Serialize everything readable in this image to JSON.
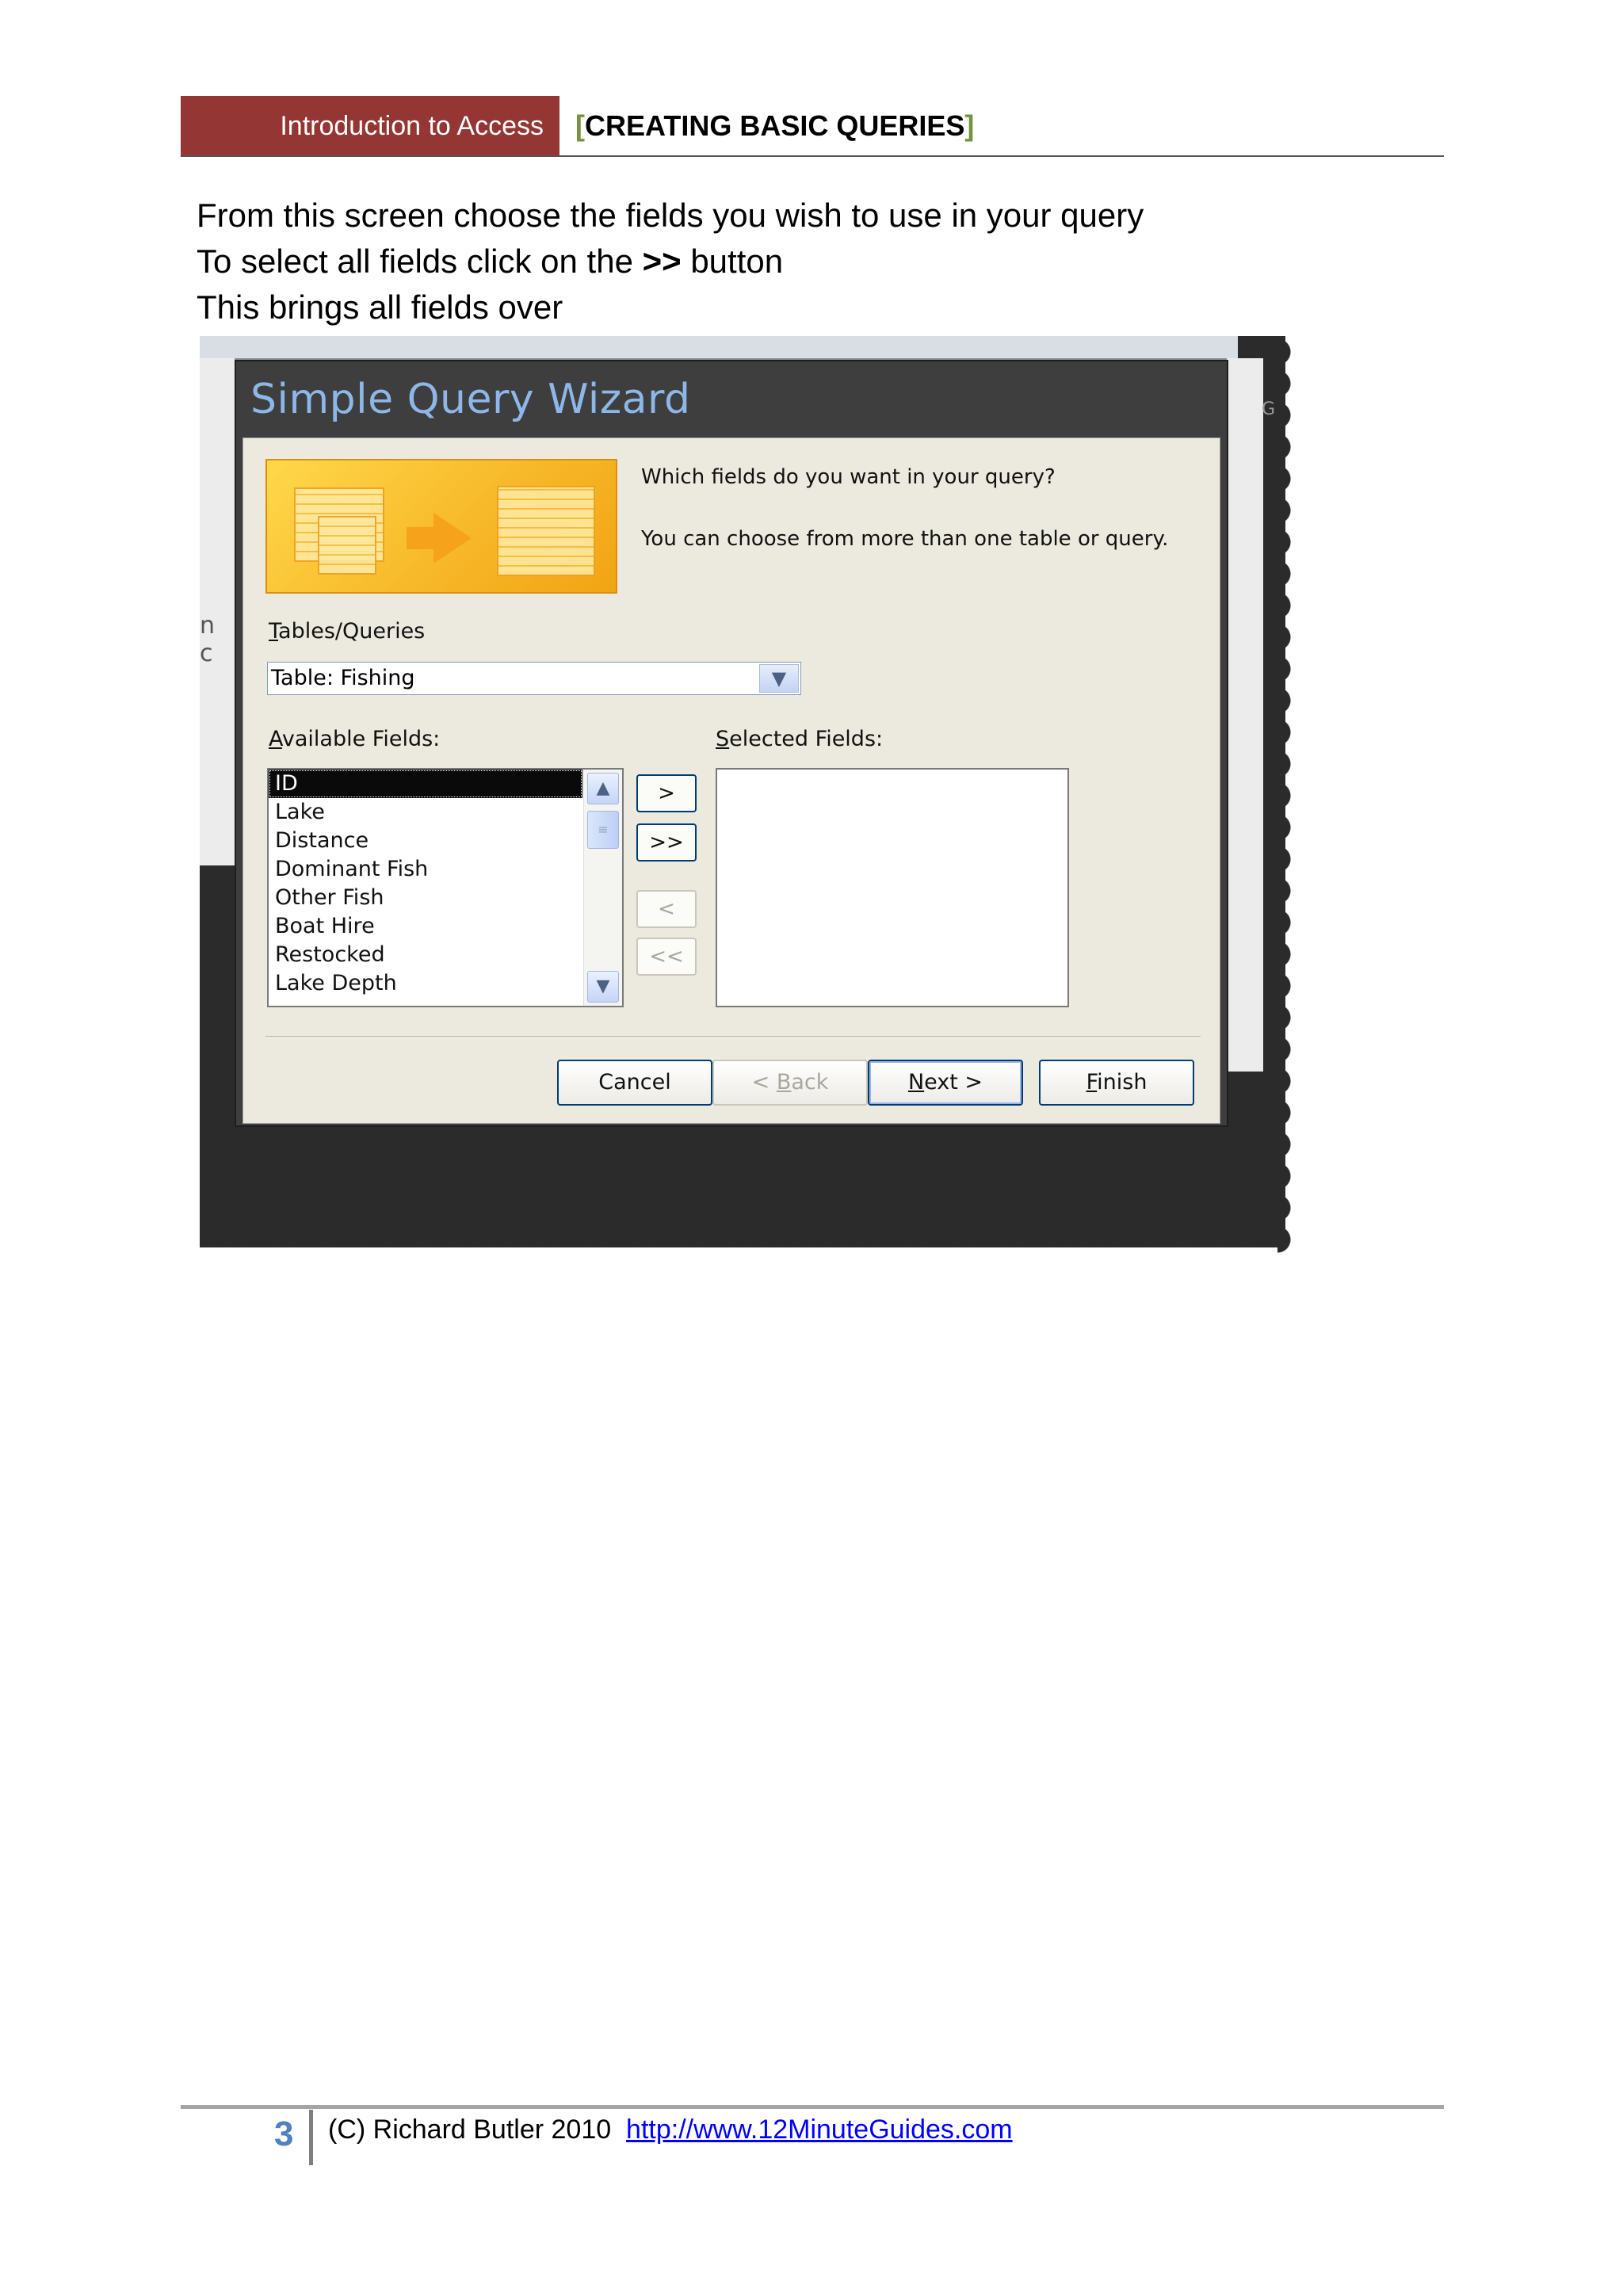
{
  "header": {
    "doc_title": "Introduction to Access",
    "section_open": "[",
    "section_title": "CREATING BASIC QUERIES",
    "section_close": "]"
  },
  "intro": {
    "line1": "From this screen choose the fields you wish to use in your query",
    "line2_pre": "To select all fields click on the ",
    "line2_bold": ">>",
    "line2_post": " button",
    "line3": "This brings all fields over"
  },
  "app_bg": {
    "left_fragment": "n c",
    "right_fragment": "G"
  },
  "wizard": {
    "title": "Simple Query Wizard",
    "question": "Which fields do you want in your query?",
    "hint": "You can choose from more than one table or query.",
    "tables_label_u": "T",
    "tables_label_rest": "ables/Queries",
    "tables_value": "Table: Fishing",
    "available_label_u": "A",
    "available_label_rest": "vailable Fields:",
    "selected_label_u": "S",
    "selected_label_rest": "elected Fields:",
    "available_fields": [
      "ID",
      "Lake",
      "Distance",
      "Dominant Fish",
      "Other Fish",
      "Boat Hire",
      "Restocked",
      "Lake Depth"
    ],
    "selected_fields": [],
    "move_buttons": {
      "add_one": ">",
      "add_all": ">>",
      "remove_one": "<",
      "remove_all": "<<"
    },
    "buttons": {
      "cancel": "Cancel",
      "back_pre": "< ",
      "back_u": "B",
      "back_rest": "ack",
      "next_u": "N",
      "next_rest": "ext >",
      "finish_u": "F",
      "finish_rest": "inish"
    }
  },
  "footer": {
    "page_number": "3",
    "copyright": "(C) Richard Butler 2010  ",
    "url": "http://www.12MinuteGuides.com"
  },
  "colors": {
    "header_red": "#943634",
    "bracket_green": "#76923c",
    "page_number_blue": "#4f81bd",
    "title_blue": "#8db7e8",
    "dialog_body": "#eceadf"
  }
}
